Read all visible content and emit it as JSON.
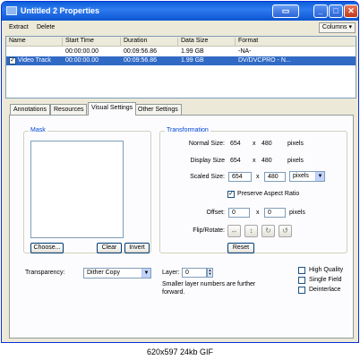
{
  "window": {
    "title": "Untitled 2 Properties",
    "controls": {
      "minimize": "_",
      "maximize": "□",
      "close": "✕"
    }
  },
  "toolbar": {
    "extract": "Extract",
    "delete": "Delete",
    "columns": "Columns ▾"
  },
  "tracks": {
    "headers": [
      "Name",
      "Start Time",
      "Duration",
      "Data Size",
      "Format"
    ],
    "rows": [
      {
        "name": "",
        "start": "00:00:00.00",
        "duration": "00:09:56.86",
        "size": "1.99 GB",
        "format": "-NA-",
        "checked": false
      },
      {
        "name": "Video Track",
        "start": "00:00:00.00",
        "duration": "00:09:56.86",
        "size": "1.99 GB",
        "format": "DV/DVCPRO - N...",
        "checked": true
      }
    ]
  },
  "tabs": [
    "Annotations",
    "Resources",
    "Visual Settings",
    "Other Settings"
  ],
  "active_tab": "Visual Settings",
  "mask": {
    "title": "Mask",
    "choose": "Choose...",
    "clear": "Clear",
    "invert": "Invert"
  },
  "transformation": {
    "title": "Transformation",
    "normal_label": "Normal Size:",
    "normal_w": "654",
    "normal_h": "480",
    "normal_unit": "pixels",
    "display_label": "Display Size",
    "display_w": "654",
    "display_h": "480",
    "display_unit": "pixels",
    "scaled_label": "Scaled Size:",
    "scaled_w": "654",
    "scaled_h": "480",
    "scaled_unit": "pixels",
    "times": "x",
    "preserve_label": "Preserve Aspect Ratio",
    "preserve_checked": true,
    "offset_label": "Offset:",
    "offset_x": "0",
    "offset_y": "0",
    "offset_unit": "pixels",
    "flip_label": "Flip/Rotate:",
    "reset": "Reset"
  },
  "transparency": {
    "label": "Transparency:",
    "value": "Dither Copy"
  },
  "layer": {
    "label": "Layer:",
    "value": "0",
    "note_line1": "Smaller layer numbers are further",
    "note_line2": "forward."
  },
  "options": {
    "high_quality": "High Quality",
    "single_field": "Single Field",
    "deinterlace": "Deinterlace"
  },
  "caption": "620x597  24kb  GIF"
}
